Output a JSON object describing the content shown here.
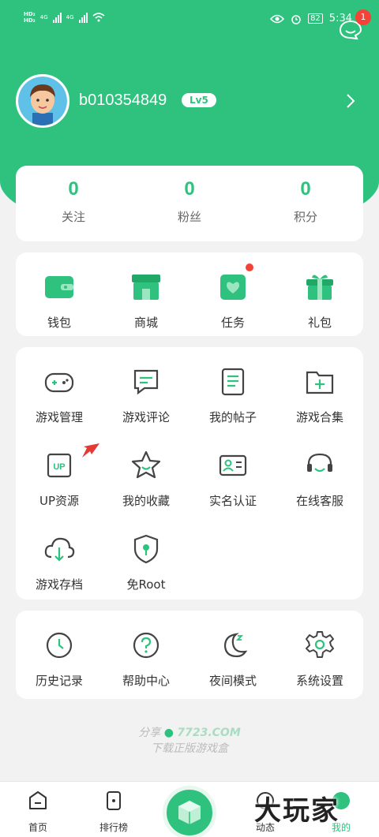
{
  "status_bar": {
    "network_left": "HD₂",
    "network_left2": "HD₂",
    "sig1": "4G",
    "sig2": "4G",
    "battery": "82",
    "time": "5:34"
  },
  "header": {
    "notification_count": "1",
    "username": "b010354849",
    "level": "Lv5"
  },
  "stats": [
    {
      "value": "0",
      "label": "关注"
    },
    {
      "value": "0",
      "label": "粉丝"
    },
    {
      "value": "0",
      "label": "积分"
    }
  ],
  "quick_actions": [
    {
      "label": "钱包",
      "icon": "wallet-icon"
    },
    {
      "label": "商城",
      "icon": "store-icon"
    },
    {
      "label": "任务",
      "icon": "task-icon"
    },
    {
      "label": "礼包",
      "icon": "gift-icon"
    }
  ],
  "tools": [
    {
      "label": "游戏管理",
      "icon": "gamepad-icon"
    },
    {
      "label": "游戏评论",
      "icon": "comment-icon"
    },
    {
      "label": "我的帖子",
      "icon": "post-icon"
    },
    {
      "label": "游戏合集",
      "icon": "folder-add-icon"
    },
    {
      "label": "UP资源",
      "icon": "up-resource-icon"
    },
    {
      "label": "我的收藏",
      "icon": "star-icon"
    },
    {
      "label": "实名认证",
      "icon": "id-card-icon"
    },
    {
      "label": "在线客服",
      "icon": "headset-icon"
    },
    {
      "label": "游戏存档",
      "icon": "cloud-download-icon"
    },
    {
      "label": "免Root",
      "icon": "shield-icon"
    }
  ],
  "settings": [
    {
      "label": "历史记录",
      "icon": "clock-icon"
    },
    {
      "label": "帮助中心",
      "icon": "help-icon"
    },
    {
      "label": "夜间模式",
      "icon": "moon-icon"
    },
    {
      "label": "系统设置",
      "icon": "gear-icon"
    }
  ],
  "share": {
    "prefix": "分享",
    "brand": "7723.COM",
    "subtitle": "下载正版游戏盒"
  },
  "bottom_nav": [
    {
      "label": "首页"
    },
    {
      "label": "排行榜"
    },
    {
      "label": "动态"
    },
    {
      "label": "我的"
    }
  ],
  "watermark": "大玩家",
  "colors": {
    "accent": "#2ec27e",
    "badge": "#f44336"
  }
}
